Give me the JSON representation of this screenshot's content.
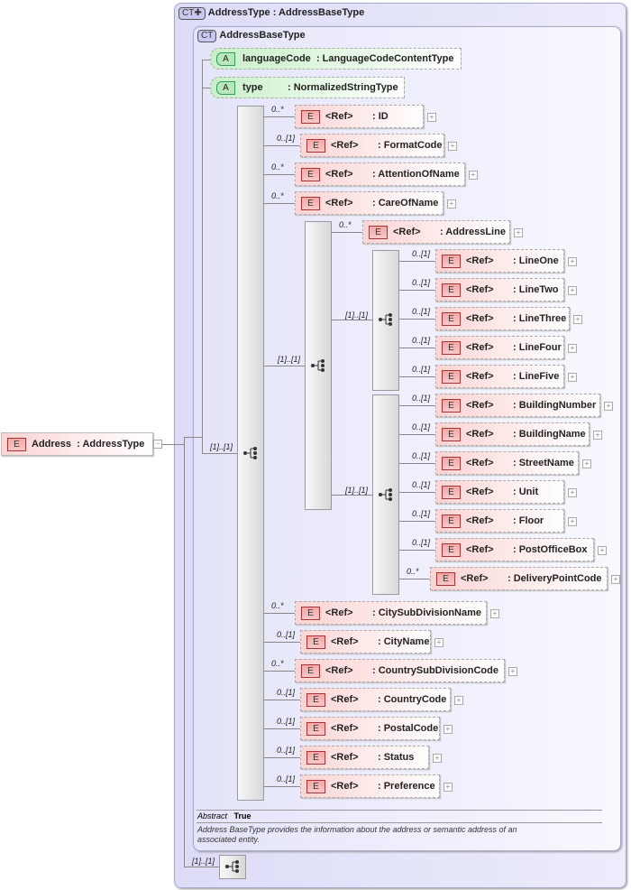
{
  "root": {
    "badge": "E",
    "name": "Address",
    "type": ": AddressType"
  },
  "outer": {
    "badge": "CT",
    "title": "AddressType : AddressBaseType"
  },
  "inner": {
    "badge": "CT",
    "title": "AddressBaseType"
  },
  "attributes": [
    {
      "badge": "A",
      "name": "languageCode",
      "type": ": LanguageCodeContentType"
    },
    {
      "badge": "A",
      "name": "type",
      "type": ": NormalizedStringType"
    }
  ],
  "seq_labels": {
    "main": "[1]..[1]",
    "sub": "[1]..[1]",
    "choice1": "[1]..[1]",
    "choice2": "[1]..[1]",
    "bottom": "[1]..[1]"
  },
  "elements": [
    {
      "mult": "0..*",
      "ref": "<Ref>",
      "name": ": ID"
    },
    {
      "mult": "0..[1]",
      "ref": "<Ref>",
      "name": ": FormatCode"
    },
    {
      "mult": "0..*",
      "ref": "<Ref>",
      "name": ": AttentionOfName"
    },
    {
      "mult": "0..*",
      "ref": "<Ref>",
      "name": ": CareOfName"
    },
    {
      "mult": "0..*",
      "ref": "<Ref>",
      "name": ": AddressLine"
    },
    {
      "mult": "0..[1]",
      "ref": "<Ref>",
      "name": ": LineOne"
    },
    {
      "mult": "0..[1]",
      "ref": "<Ref>",
      "name": ": LineTwo"
    },
    {
      "mult": "0..[1]",
      "ref": "<Ref>",
      "name": ": LineThree"
    },
    {
      "mult": "0..[1]",
      "ref": "<Ref>",
      "name": ": LineFour"
    },
    {
      "mult": "0..[1]",
      "ref": "<Ref>",
      "name": ": LineFive"
    },
    {
      "mult": "0..[1]",
      "ref": "<Ref>",
      "name": ": BuildingNumber"
    },
    {
      "mult": "0..[1]",
      "ref": "<Ref>",
      "name": ": BuildingName"
    },
    {
      "mult": "0..[1]",
      "ref": "<Ref>",
      "name": ": StreetName"
    },
    {
      "mult": "0..[1]",
      "ref": "<Ref>",
      "name": ": Unit"
    },
    {
      "mult": "0..[1]",
      "ref": "<Ref>",
      "name": ": Floor"
    },
    {
      "mult": "0..[1]",
      "ref": "<Ref>",
      "name": ": PostOfficeBox"
    },
    {
      "mult": "0..*",
      "ref": "<Ref>",
      "name": ": DeliveryPointCode"
    },
    {
      "mult": "0..*",
      "ref": "<Ref>",
      "name": ": CitySubDivisionName"
    },
    {
      "mult": "0..[1]",
      "ref": "<Ref>",
      "name": ": CityName"
    },
    {
      "mult": "0..*",
      "ref": "<Ref>",
      "name": ": CountrySubDivisionCode"
    },
    {
      "mult": "0..[1]",
      "ref": "<Ref>",
      "name": ": CountryCode"
    },
    {
      "mult": "0..[1]",
      "ref": "<Ref>",
      "name": ": PostalCode"
    },
    {
      "mult": "0..[1]",
      "ref": "<Ref>",
      "name": ": Status"
    },
    {
      "mult": "0..[1]",
      "ref": "<Ref>",
      "name": ": Preference"
    }
  ],
  "element_badge": "E",
  "footer": {
    "abstract_label": "Abstract",
    "abstract_value": "True",
    "description": "Address BaseType provides the information about the address or semantic address of an associated entity."
  }
}
